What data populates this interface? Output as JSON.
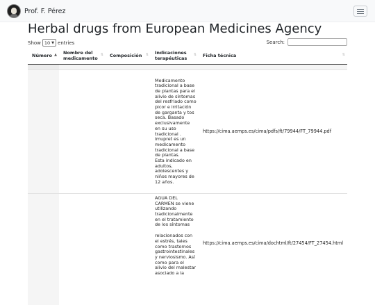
{
  "navbar": {
    "brand_name": "Prof. F. Pérez",
    "toggle_icon": "hamburger-menu-icon",
    "avatar_icon": "profile-photo-icon"
  },
  "page": {
    "title": "Herbal drugs from European Medicines Agency"
  },
  "datatable": {
    "length_prefix": "Show",
    "length_value": "10",
    "length_suffix": "entries",
    "search_label": "Search:",
    "search_value": "",
    "columns": [
      {
        "label": "Número",
        "sort": "ascending"
      },
      {
        "label": "Nombre del medicamento",
        "sort": "none"
      },
      {
        "label": "Composición",
        "sort": "none"
      },
      {
        "label": "Indicaciones terapéuticas",
        "sort": "none"
      },
      {
        "label": "Ficha técnica",
        "sort": "none"
      }
    ],
    "rows": [
      {
        "numero": "",
        "nombre": "",
        "composicion": "",
        "indicaciones": [
          "Medicamento tradicional a base de plantas para el alivio de síntomas del resfriado como picor e irritación de garganta y tos seca. Basado exclusivamente en su uso tradicional .",
          "Imupret es un medicamento tradicional a base de plantas.",
          "Esta indicado en adultos, adolescentes y niños mayores de 12 años."
        ],
        "ficha": "https://cima.aemps.es/cima/pdfs/ft/79944/FT_79944.pdf"
      },
      {
        "numero": "",
        "nombre": "",
        "composicion": "",
        "indicaciones": [
          "AGUA DEL CARMEN se viene utilizando tradicionalmente en el tratamiento de los síntomas",
          "",
          "relacionados con el estrés, tales como trastornos gastrointestinales y nerviosismo. Así como para el alivio del malestar asociado a la"
        ],
        "ficha": "https://cima.aemps.es/cima/dochtml/ft/27454/FT_27454.html"
      }
    ]
  }
}
